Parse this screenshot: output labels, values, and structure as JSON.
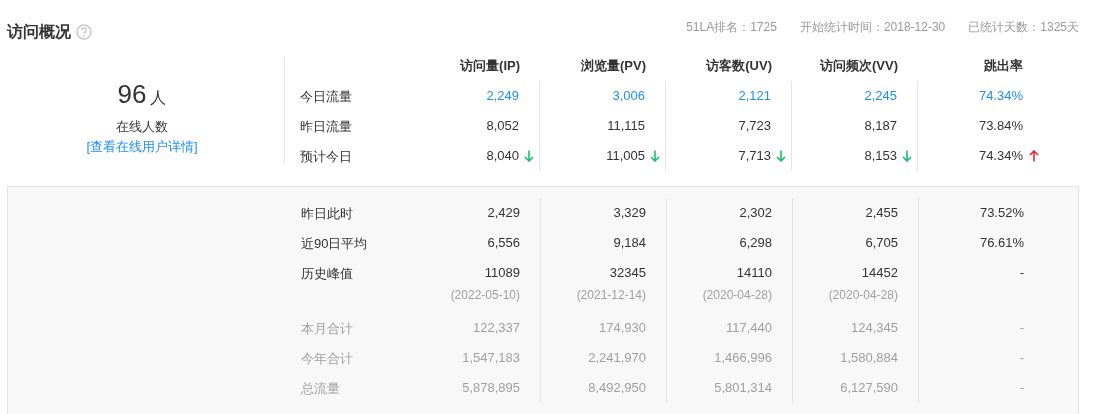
{
  "title": "访问概况",
  "meta": [
    "51LA排名：1725",
    "开始统计时间：2018-12-30",
    "已统计天数：1325天"
  ],
  "online": {
    "count": "96",
    "unit": "人",
    "label": "在线人数",
    "link": "[查看在线用户详情]"
  },
  "columns": [
    "访问量(IP)",
    "浏览量(PV)",
    "访客数(UV)",
    "访问频次(VV)",
    "跳出率"
  ],
  "today_rows": [
    {
      "label": "今日流量",
      "highlighted": true,
      "muted": false,
      "cells": [
        {
          "value": "2,249"
        },
        {
          "value": "3,006"
        },
        {
          "value": "2,121"
        },
        {
          "value": "2,245"
        },
        {
          "value": "74.34%"
        }
      ]
    },
    {
      "label": "昨日流量",
      "highlighted": false,
      "muted": false,
      "cells": [
        {
          "value": "8,052"
        },
        {
          "value": "11,115"
        },
        {
          "value": "7,723"
        },
        {
          "value": "8,187"
        },
        {
          "value": "73.84%"
        }
      ]
    },
    {
      "label": "预计今日",
      "highlighted": false,
      "muted": false,
      "cells": [
        {
          "value": "8,040",
          "falling": true
        },
        {
          "value": "11,005",
          "falling": true
        },
        {
          "value": "7,713",
          "falling": true
        },
        {
          "value": "8,153",
          "falling": true
        },
        {
          "value": "74.34%",
          "rising": true
        }
      ]
    }
  ],
  "history_rows": [
    {
      "label": "昨日此时",
      "highlighted": false,
      "muted": false,
      "cells": [
        {
          "value": "2,429"
        },
        {
          "value": "3,329"
        },
        {
          "value": "2,302"
        },
        {
          "value": "2,455"
        },
        {
          "value": "73.52%"
        }
      ]
    },
    {
      "label": "近90日平均",
      "highlighted": false,
      "muted": false,
      "cells": [
        {
          "value": "6,556"
        },
        {
          "value": "9,184"
        },
        {
          "value": "6,298"
        },
        {
          "value": "6,705"
        },
        {
          "value": "76.61%"
        }
      ]
    },
    {
      "label": "历史峰值",
      "highlighted": false,
      "muted": false,
      "cells": [
        {
          "value": "11089",
          "date": "(2022-05-10)"
        },
        {
          "value": "32345",
          "date": "(2021-12-14)"
        },
        {
          "value": "14110",
          "date": "(2020-04-28)"
        },
        {
          "value": "14452",
          "date": "(2020-04-28)"
        },
        {
          "value": "-"
        }
      ]
    },
    {
      "label": "本月合计",
      "highlighted": false,
      "muted": true,
      "cells": [
        {
          "value": "122,337"
        },
        {
          "value": "174,930"
        },
        {
          "value": "117,440"
        },
        {
          "value": "124,345"
        },
        {
          "value": "-"
        }
      ]
    },
    {
      "label": "今年合计",
      "highlighted": false,
      "muted": true,
      "cells": [
        {
          "value": "1,547,183"
        },
        {
          "value": "2,241,970"
        },
        {
          "value": "1,466,996"
        },
        {
          "value": "1,580,884"
        },
        {
          "value": "-"
        }
      ]
    },
    {
      "label": "总流量",
      "highlighted": false,
      "muted": true,
      "cells": [
        {
          "value": "5,878,895"
        },
        {
          "value": "8,492,950"
        },
        {
          "value": "5,801,314"
        },
        {
          "value": "6,127,590"
        },
        {
          "value": "-"
        }
      ]
    }
  ]
}
